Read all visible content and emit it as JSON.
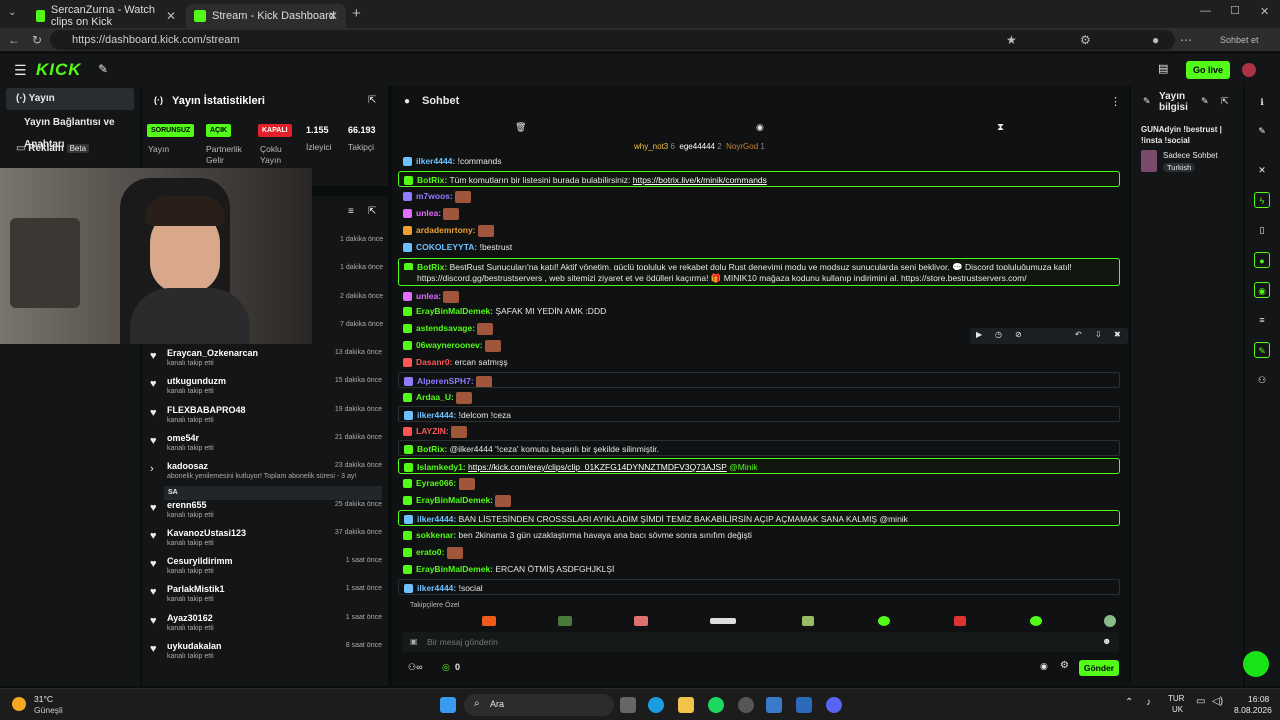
{
  "browser": {
    "tabs": [
      {
        "title": "SercanZurna - Watch clips on Kick"
      },
      {
        "title": "Stream - Kick Dashboard"
      }
    ],
    "url": "https://dashboard.kick.com/stream",
    "profile_label": "Sohbet et"
  },
  "kick": {
    "logo": "KICK",
    "golive": "Go live"
  },
  "leftnav": {
    "items": [
      {
        "label": "Yayın"
      },
      {
        "label": "Yayın Bağlantısı ve Anahtarı"
      },
      {
        "label": "Reklam",
        "badge": "Beta"
      }
    ]
  },
  "stats": {
    "title": "Yayın İstatistikleri",
    "cells": [
      {
        "badge": "SORUNSUZ",
        "label": "Yayın"
      },
      {
        "badge": "AÇIK",
        "label": "Partnerlik Gelir"
      },
      {
        "badge": "KAPALI",
        "label": "Çoklu Yayın"
      },
      {
        "value": "1.155",
        "label": "İzleyici"
      },
      {
        "value": "66.193",
        "label": "Takipçi"
      }
    ]
  },
  "activity": {
    "top_times": [
      "1 dakika önce",
      "1 dakika önce",
      "2 dakika önce",
      "7 dakika önce"
    ],
    "items": [
      {
        "name": "Eraycan_Ozkenarcan",
        "sub": "kanalı takip etti",
        "time": "13 dakika önce"
      },
      {
        "name": "utkugunduzm",
        "sub": "kanalı takip etti",
        "time": "15 dakika önce"
      },
      {
        "name": "FLEXBABAPRO48",
        "sub": "kanalı takip etti",
        "time": "19 dakika önce"
      },
      {
        "name": "ome54r",
        "sub": "kanalı takip etti",
        "time": "21 dakika önce"
      },
      {
        "name": "kadoosaz",
        "sub": "abonelik yenilemesini kutluyor! Toplam abonelik süresi - 3 ay!",
        "time": "23 dakika önce",
        "extra": "SA"
      },
      {
        "name": "erenn655",
        "sub": "kanalı takip etti",
        "time": "25 dakika önce"
      },
      {
        "name": "KavanozUstasi123",
        "sub": "kanalı takip etti",
        "time": "37 dakika önce"
      },
      {
        "name": "Cesuryildirimm",
        "sub": "kanalı takip etti",
        "time": "1 saat önce"
      },
      {
        "name": "ParlakMistik1",
        "sub": "kanalı takip etti",
        "time": "1 saat önce"
      },
      {
        "name": "Ayaz30162",
        "sub": "kanalı takip etti",
        "time": "1 saat önce"
      },
      {
        "name": "uykudakalan",
        "sub": "kanalı takip etti",
        "time": "8 saat önce"
      }
    ]
  },
  "chat": {
    "title": "Sohbet",
    "top_users": [
      {
        "name": "why_not3",
        "n": "6"
      },
      {
        "name": "ege44444",
        "n": "2"
      },
      {
        "name": "NoyrGod",
        "n": "1"
      }
    ],
    "messages": [
      {
        "user": "ilker4444:",
        "text": " !commands",
        "color": "#6ec1ff",
        "style": ""
      },
      {
        "user": "BotRix:",
        "text": " Tüm komutların bir listesini burada bulabilirsiniz: ",
        "link": "https://botrix.live/k/minik/commands",
        "color": "#53fc18",
        "style": "hl"
      },
      {
        "user": "m7woos:",
        "text": "",
        "color": "#8f7cff",
        "emote": true
      },
      {
        "user": "unlea:",
        "text": "",
        "color": "#e26fff",
        "emote": true
      },
      {
        "user": "ardademrtony:",
        "text": "",
        "color": "#f0a030",
        "emote": true
      },
      {
        "user": "COKOLEYYTA:",
        "text": " !bestrust",
        "color": "#6ec1ff"
      },
      {
        "user": "BotRix:",
        "text": " BestRust Sunucuları'na katıl! Aktif yönetim, güçlü topluluk ve rekabet dolu Rust deneyimi modu ve modsuz sunucularda seni bekliyor. 💬 Discord topluluğumuza katıl!",
        "color": "#53fc18",
        "style": "hl"
      },
      {
        "user": "",
        "text": "https://discord.gg/bestrustservers , web sitemizi ziyaret et ve ödülleri kaçırma! 🎁 MINIK10 mağaza kodunu kullanıp indirimini al. https://store.bestrustservers.com/",
        "color": "#fff",
        "style": "hlcont"
      },
      {
        "user": "unlea:",
        "text": "",
        "color": "#e26fff",
        "emote": true
      },
      {
        "user": "ErayBinMalDemek:",
        "text": " ŞAFAK MI YEDİN AMK :DDD",
        "color": "#53fc18"
      },
      {
        "user": "astendsavage:",
        "text": "",
        "color": "#53fc18",
        "emote": true
      },
      {
        "user": "06wayneroonev:",
        "text": "",
        "color": "#53fc18",
        "emote": true
      },
      {
        "user": "Dasanr0:",
        "text": " ercan satmışş",
        "color": "#ff5555"
      },
      {
        "user": "AlperenSPH7:",
        "text": "",
        "color": "#8f7cff",
        "emote": true,
        "style": "hl2"
      },
      {
        "user": "Ardaa_U:",
        "text": "",
        "color": "#53fc18",
        "emote": true
      },
      {
        "user": "ilker4444:",
        "text": " !delcom !ceza",
        "color": "#6ec1ff",
        "style": "hl2"
      },
      {
        "user": "LAYZIN:",
        "text": "",
        "color": "#ff5555",
        "emote": true
      },
      {
        "user": "BotRix:",
        "text": " @ilker4444 '!ceza' komutu başarılı bir şekilde silinmiştir.",
        "color": "#53fc18",
        "style": "hl2"
      },
      {
        "user": "Islamkedy1:",
        "text": " ",
        "link": "https://kick.com/eray/clips/clip_01KZFG14DYNNZTMDFV3Q73AJSP",
        "tail": " @Minik",
        "color": "#53fc18",
        "style": "hl"
      },
      {
        "user": "Eyrae066:",
        "text": "",
        "color": "#53fc18",
        "emote": true
      },
      {
        "user": "ErayBinMalDemek:",
        "text": "",
        "color": "#53fc18",
        "emote": true
      },
      {
        "user": "ilker4444:",
        "text": " BAN LİSTESİNDEN CROSSSLARI AYIKLADIM ŞİMDİ TEMİZ BAKABİLİRSİN AÇIP AÇMAMAK SANA KALMIŞ @minik",
        "color": "#6ec1ff",
        "style": "hl"
      },
      {
        "user": "sokkenar:",
        "text": " ben 2kinama 3 gün uzaklaştırma havaya ana bacı sövme sonra sınıfım değişti",
        "color": "#53fc18"
      },
      {
        "user": "erato0:",
        "text": "",
        "color": "#53fc18",
        "emote": true
      },
      {
        "user": "ErayBinMalDemek:",
        "text": " ERCAN ÖTMİŞ ASDFGHJKLŞİ",
        "color": "#53fc18"
      },
      {
        "user": "ilker4444:",
        "text": " !social",
        "color": "#6ec1ff",
        "style": "hl2"
      }
    ],
    "special_label": "Takipçilere Özel",
    "input_placeholder": "Bir mesaj gönderin",
    "viewer_count": "0",
    "send": "Gönder"
  },
  "info": {
    "title": "Yayın bilgisi",
    "stream_title": "GUNAdyin !bestrust | !insta !social",
    "mode": "Sadece Sohbet",
    "language": "Turkish"
  },
  "taskbar": {
    "weather_temp": "31°C",
    "weather_desc": "Güneşli",
    "search": "Ara",
    "lang": "TUR",
    "lang2": "UK",
    "time": "16:08",
    "date": "8.08.2026"
  },
  "colors": {
    "accent": "#53fc18",
    "bg": "#0b0e0f",
    "panel": "#141517"
  }
}
